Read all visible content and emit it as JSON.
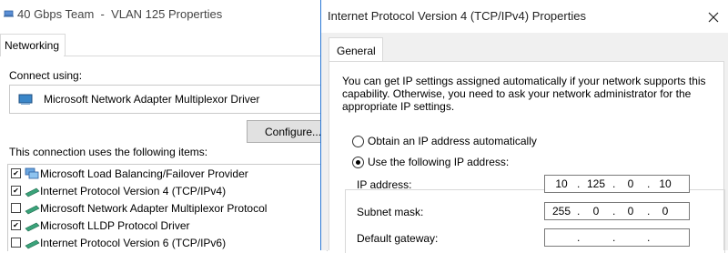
{
  "background_window": {
    "title": "40 Gbps Team  -  VLAN 125 Properties",
    "tab": "Networking",
    "connect_using_label": "Connect using:",
    "adapter_name": "Microsoft Network Adapter Multiplexor Driver",
    "configure_button": "Configure...",
    "items_label": "This connection uses the following items:",
    "items": [
      {
        "label": "Microsoft Load Balancing/Failover Provider",
        "checked": true,
        "icon": "network-service-icon"
      },
      {
        "label": "Internet Protocol Version 4 (TCP/IPv4)",
        "checked": true,
        "icon": "protocol-icon"
      },
      {
        "label": "Microsoft Network Adapter Multiplexor Protocol",
        "checked": false,
        "icon": "protocol-icon"
      },
      {
        "label": "Microsoft LLDP Protocol Driver",
        "checked": true,
        "icon": "protocol-icon"
      },
      {
        "label": "Internet Protocol Version 6 (TCP/IPv6)",
        "checked": false,
        "icon": "protocol-icon"
      }
    ]
  },
  "dialog": {
    "title": "Internet Protocol Version 4 (TCP/IPv4) Properties",
    "tab": "General",
    "intro_text": "You can get IP settings assigned automatically if your network supports this capability. Otherwise, you need to ask your network administrator for the appropriate IP settings.",
    "radio_auto": {
      "label": "Obtain an IP address automatically",
      "selected": false
    },
    "radio_manual": {
      "label": "Use the following IP address:",
      "selected": true
    },
    "fields": {
      "ip_address": {
        "label": "IP address:",
        "octets": [
          "10",
          "125",
          "0",
          "10"
        ]
      },
      "subnet_mask": {
        "label": "Subnet mask:",
        "octets": [
          "255",
          "0",
          "0",
          "0"
        ]
      },
      "default_gateway": {
        "label": "Default gateway:",
        "octets": [
          "",
          "",
          "",
          ""
        ]
      }
    }
  },
  "colors": {
    "dialog_border": "#2b79d6",
    "dialog_body": "#f0f0f0"
  }
}
